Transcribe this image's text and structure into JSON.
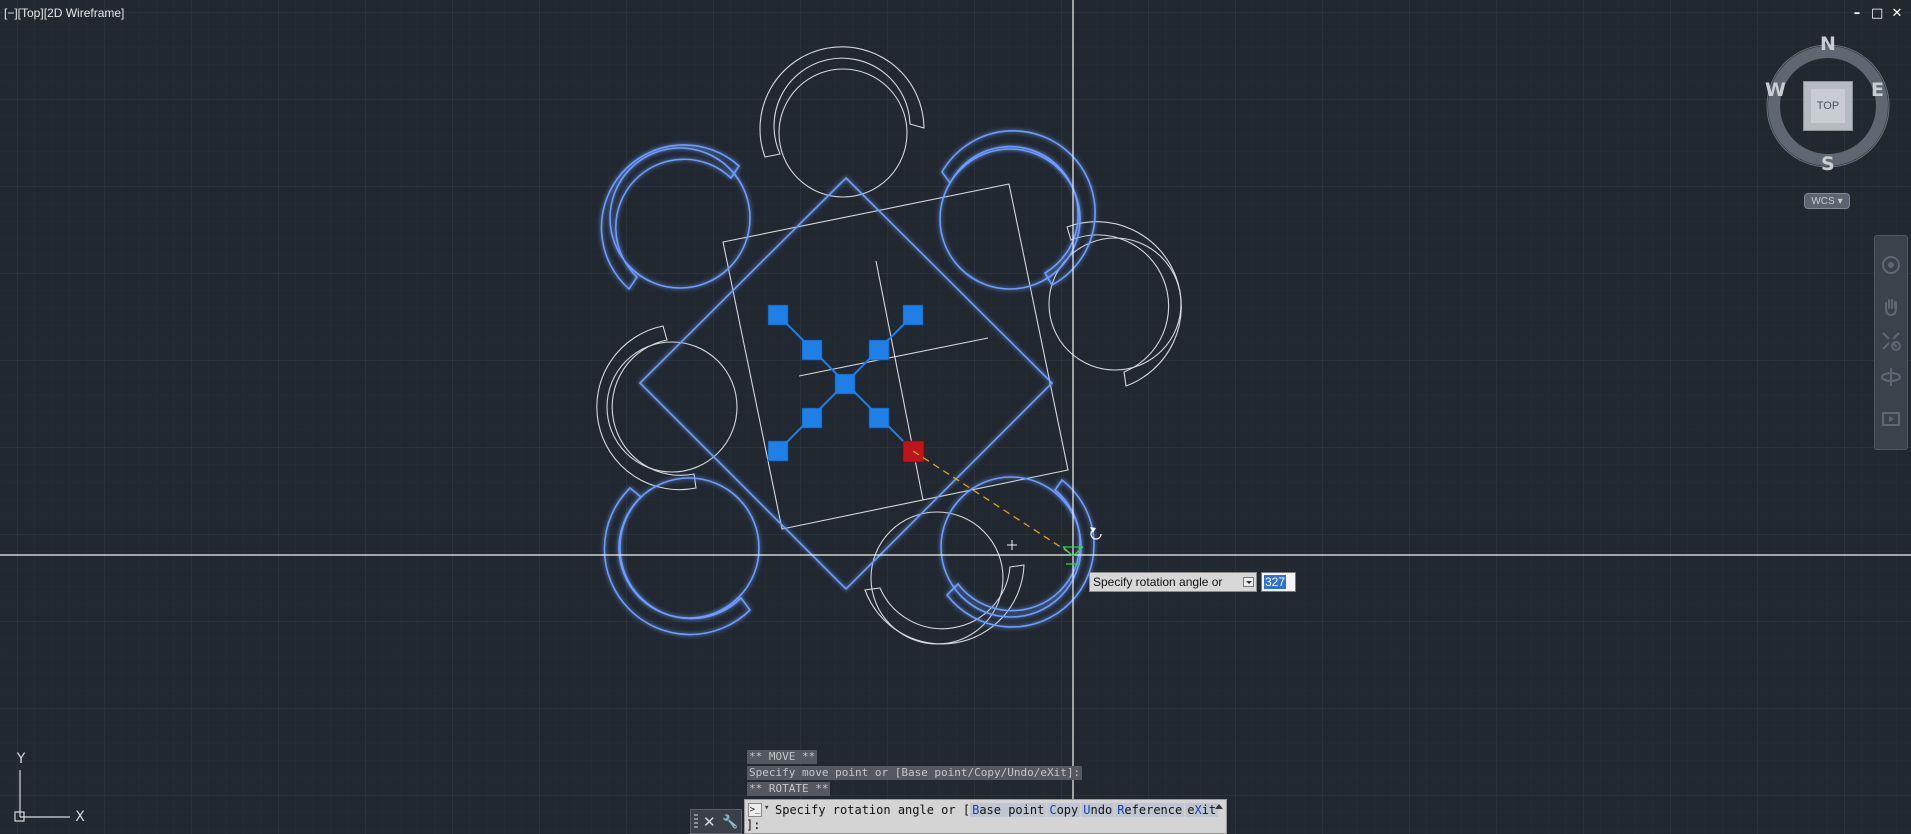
{
  "viewport": {
    "label": "[−][Top][2D Wireframe]",
    "window_controls": [
      "–",
      "□",
      "✕"
    ]
  },
  "viewcube": {
    "north": "N",
    "south": "S",
    "east": "E",
    "west": "W",
    "face": "TOP",
    "ucs_menu": "WCS",
    "ucs_menu_arrow": "▾"
  },
  "ucs_icon": {
    "x_label": "X",
    "y_label": "Y"
  },
  "dynamic_input": {
    "prompt": "Specify rotation angle or",
    "value": "327"
  },
  "command_history": [
    "** MOVE **",
    "Specify move point or [Base point/Copy/Undo/eXit]:",
    "** ROTATE **"
  ],
  "command_line": {
    "prefix": "Specify rotation angle or [",
    "options": [
      {
        "key": "B",
        "rest": "ase point"
      },
      {
        "key": "C",
        "rest": "opy"
      },
      {
        "key": "U",
        "rest": "ndo"
      },
      {
        "key": "R",
        "rest": "eference"
      },
      {
        "key": "",
        "rest": "e",
        "key2": "X",
        "rest2": "it"
      }
    ],
    "tail": "]:"
  },
  "colors": {
    "background": "#212830",
    "grid": "#2c3540",
    "selected_outline": "#6d9cff",
    "grip": "#1e7fe6",
    "hot_grip": "#c0141c",
    "wire": "#d5d8dc"
  }
}
